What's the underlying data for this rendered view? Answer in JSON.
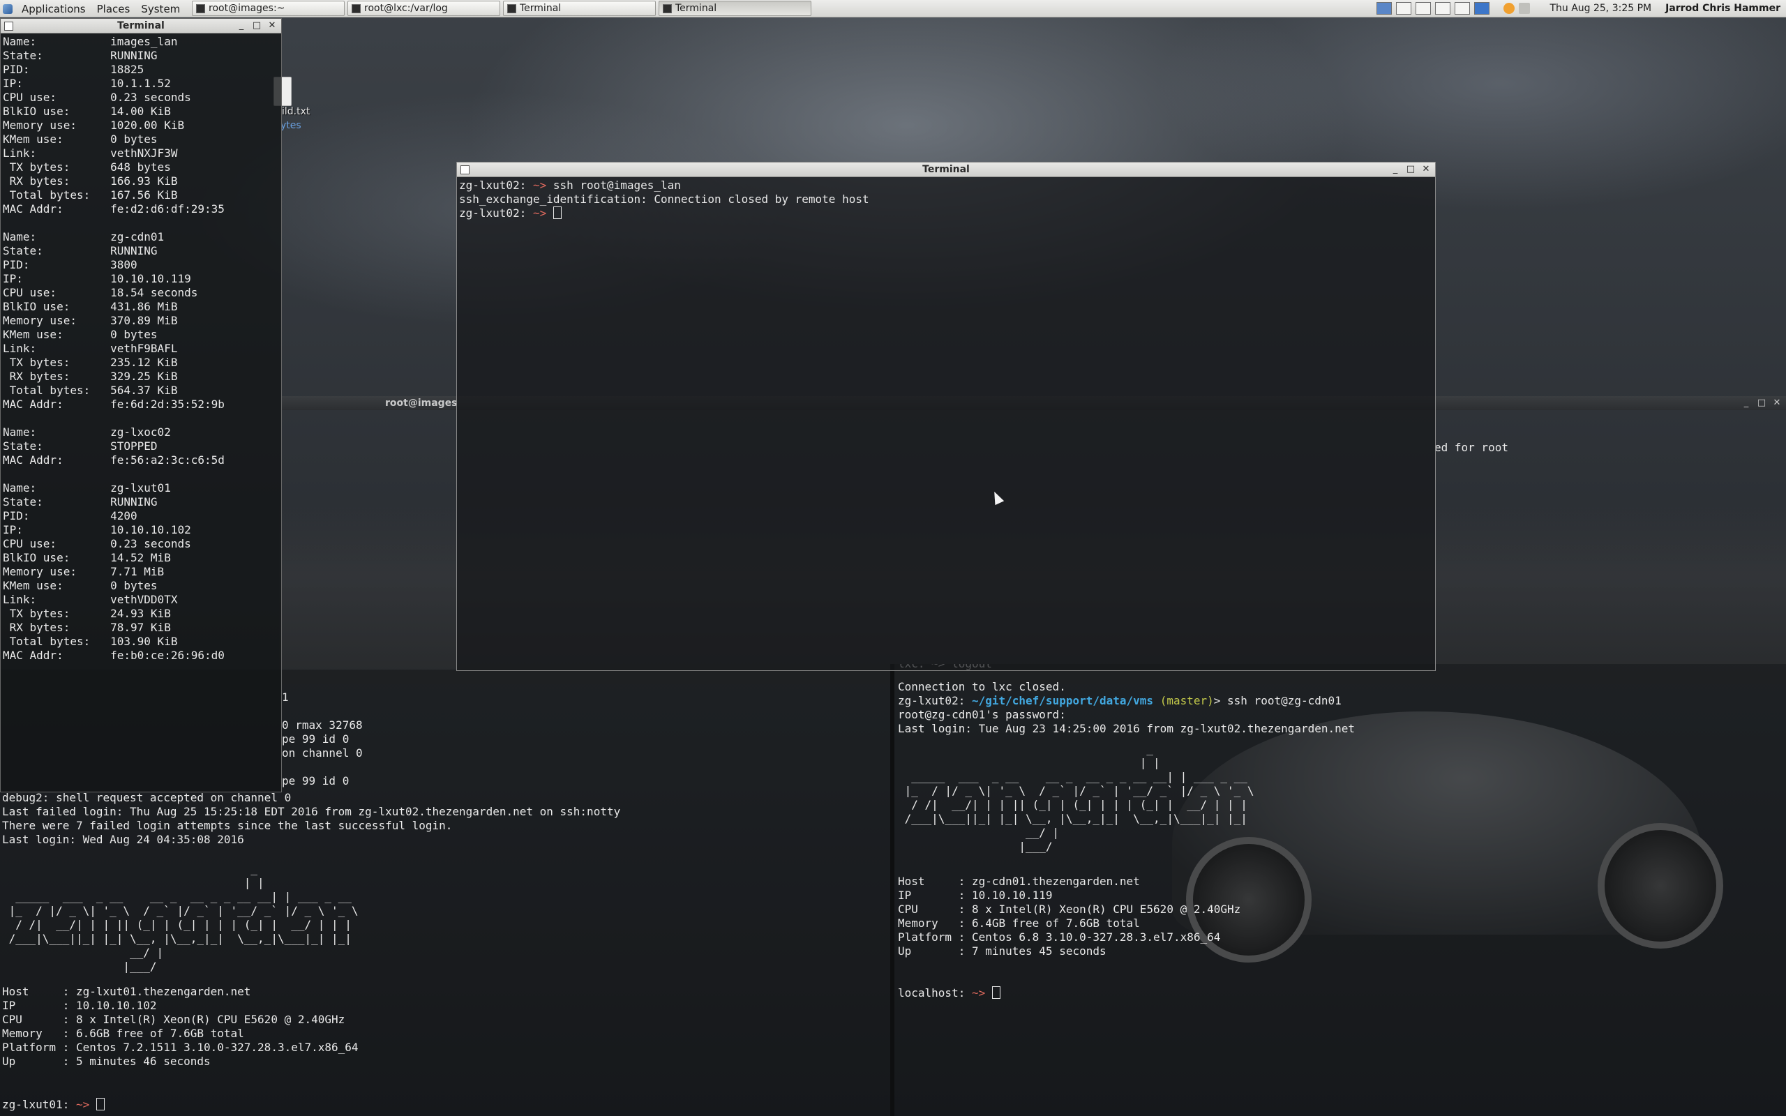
{
  "panel": {
    "menus": [
      "Applications",
      "Places",
      "System"
    ],
    "tasks": [
      "root@images:~",
      "root@lxc:/var/log",
      "Terminal",
      "Terminal"
    ],
    "clock": "Thu Aug 25,  3:25 PM",
    "user": "Jarrod Chris Hammer",
    "icons": [
      "workspace-switcher-icon",
      "weather-sun-icon",
      "volume-muted-icon"
    ]
  },
  "desktop": {
    "file_label": "ild.txt",
    "file_size": "ytes"
  },
  "lxc_info_window": {
    "title": "Terminal",
    "text": "Name:           images_lan\nState:          RUNNING\nPID:            18825\nIP:             10.1.1.52\nCPU use:        0.23 seconds\nBlkIO use:      14.00 KiB\nMemory use:     1020.00 KiB\nKMem use:       0 bytes\nLink:           vethNXJF3W\n TX bytes:      648 bytes\n RX bytes:      166.93 KiB\n Total bytes:   167.56 KiB\nMAC Addr:       fe:d2:d6:df:29:35\n\nName:           zg-cdn01\nState:          RUNNING\nPID:            3800\nIP:             10.10.10.119\nCPU use:        18.54 seconds\nBlkIO use:      431.86 MiB\nMemory use:     370.89 MiB\nKMem use:       0 bytes\nLink:           vethF9BAFL\n TX bytes:      235.12 KiB\n RX bytes:      329.25 KiB\n Total bytes:   564.37 KiB\nMAC Addr:       fe:6d:2d:35:52:9b\n\nName:           zg-lxoc02\nState:          STOPPED\nMAC Addr:       fe:56:a2:3c:c6:5d\n\nName:           zg-lxut01\nState:          RUNNING\nPID:            4200\nIP:             10.10.10.102\nCPU use:        0.23 seconds\nBlkIO use:      14.52 MiB\nMemory use:     7.71 MiB\nKMem use:       0 bytes\nLink:           vethVDD0TX\n TX bytes:      24.93 KiB\n RX bytes:      78.97 KiB\n Total bytes:   103.90 KiB\nMAC Addr:       fe:b0:ce:26:96:d0"
  },
  "ssh_window": {
    "title": "Terminal",
    "line1_host": "zg-lxut02:",
    "line1_prompt": "~>",
    "line1_cmd": " ssh root@images_lan",
    "line2": "ssh_exchange_identification: Connection closed by remote host",
    "line3_host": "zg-lxut02:",
    "line3_prompt": "~>"
  },
  "background_window": {
    "title_fragment": "root@images",
    "right_fragment": "ed for root"
  },
  "left_bottom_window": {
    "partial_text": "1\n\n0 rmax 32768\npe 99 id 0\non channel 0\n\npe 99 id 0",
    "text": "debug2: shell request accepted on channel 0\nLast failed login: Thu Aug 25 15:25:18 EDT 2016 from zg-lxut02.thezengarden.net on ssh:notty\nThere were 7 failed login attempts since the last successful login.\nLast login: Wed Aug 24 04:35:08 2016",
    "banner": "                                     _\n                                    | |\n  _____  ___  _ __    __ _  __ _ _ __ __| | ___ _ __\n |_  / |/ _ \\| '_ \\  / _` |/ _` | '__/ _` |/ _ \\ '_ \\\n  / /|  __/| | | || (_| | (_| | | | (_| |  __/ | | |\n /___|\\___||_| |_| \\__, |\\__,_|_|  \\__,_|\\___|_| |_|\n                   __/ |\n                  |___/",
    "info": "Host     : zg-lxut01.thezengarden.net\nIP       : 10.10.10.102\nCPU      : 8 x Intel(R) Xeon(R) CPU E5620 @ 2.40GHz\nMemory   : 6.6GB free of 7.6GB total\nPlatform : Centos 7.2.1511 3.10.0-327.28.3.el7.x86_64\nUp       : 5 minutes 46 seconds",
    "prompt_host": "zg-lxut01:",
    "prompt": "~>"
  },
  "right_bottom_window": {
    "line0": "lxc: ~> logout",
    "line1": "Connection to lxc closed.",
    "line2_host": "zg-lxut02:",
    "line2_path": "~/git/chef/support/data/vms",
    "line2_branch": "(master)",
    "line2_cmd": "> ssh root@zg-cdn01",
    "line3": "root@zg-cdn01's password:",
    "line4": "Last login: Tue Aug 23 14:25:00 2016 from zg-lxut02.thezengarden.net",
    "banner": "                                     _\n                                    | |\n  _____  ___  _ __    __ _  __ _ _ __ __| | ___ _ __\n |_  / |/ _ \\| '_ \\  / _` |/ _` | '__/ _` |/ _ \\ '_ \\\n  / /|  __/| | | || (_| | (_| | | | (_| |  __/ | | |\n /___|\\___||_| |_| \\__, |\\__,_|_|  \\__,_|\\___|_| |_|\n                   __/ |\n                  |___/",
    "info": "Host     : zg-cdn01.thezengarden.net\nIP       : 10.10.10.119\nCPU      : 8 x Intel(R) Xeon(R) CPU E5620 @ 2.40GHz\nMemory   : 6.4GB free of 7.6GB total\nPlatform : Centos 6.8 3.10.0-327.28.3.el7.x86_64\nUp       : 7 minutes 45 seconds",
    "prompt_host": "localhost:",
    "prompt": "~>"
  },
  "colors": {
    "prompt_arrow": "#e06a5e",
    "git_path": "#42a8e0",
    "git_branch": "#c2c84a"
  }
}
